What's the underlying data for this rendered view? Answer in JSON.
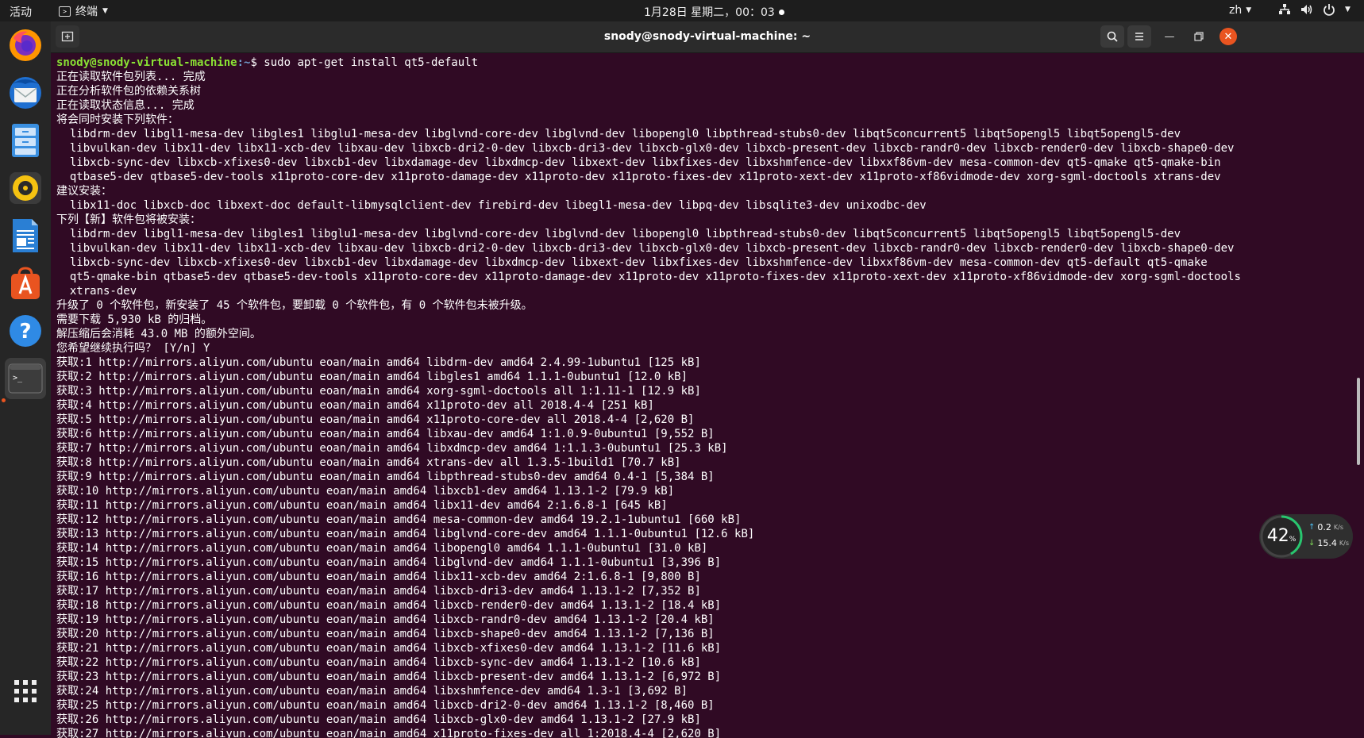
{
  "topbar": {
    "activities": "活动",
    "app_name": "终端",
    "clock": "1月28日 星期二，00：03",
    "lang": "zh"
  },
  "dock": {
    "items": [
      {
        "name": "firefox-icon"
      },
      {
        "name": "thunderbird-icon"
      },
      {
        "name": "files-icon"
      },
      {
        "name": "rhythmbox-icon"
      },
      {
        "name": "writer-icon"
      },
      {
        "name": "software-icon"
      },
      {
        "name": "help-icon"
      },
      {
        "name": "terminal-icon"
      },
      {
        "name": "show-apps-icon"
      }
    ]
  },
  "window": {
    "title": "snody@snody-virtual-machine: ~"
  },
  "terminal": {
    "prompt_user": "snody@snody-virtual-machine",
    "prompt_path": ":~",
    "prompt_cmd": "$ sudo apt-get install qt5-default",
    "lines": [
      "正在读取软件包列表... 完成",
      "正在分析软件包的依赖关系树",
      "正在读取状态信息... 完成",
      "将会同时安装下列软件：",
      "  libdrm-dev libgl1-mesa-dev libgles1 libglu1-mesa-dev libglvnd-core-dev libglvnd-dev libopengl0 libpthread-stubs0-dev libqt5concurrent5 libqt5opengl5 libqt5opengl5-dev",
      "  libvulkan-dev libx11-dev libx11-xcb-dev libxau-dev libxcb-dri2-0-dev libxcb-dri3-dev libxcb-glx0-dev libxcb-present-dev libxcb-randr0-dev libxcb-render0-dev libxcb-shape0-dev",
      "  libxcb-sync-dev libxcb-xfixes0-dev libxcb1-dev libxdamage-dev libxdmcp-dev libxext-dev libxfixes-dev libxshmfence-dev libxxf86vm-dev mesa-common-dev qt5-qmake qt5-qmake-bin",
      "  qtbase5-dev qtbase5-dev-tools x11proto-core-dev x11proto-damage-dev x11proto-dev x11proto-fixes-dev x11proto-xext-dev x11proto-xf86vidmode-dev xorg-sgml-doctools xtrans-dev",
      "建议安装：",
      "  libx11-doc libxcb-doc libxext-doc default-libmysqlclient-dev firebird-dev libegl1-mesa-dev libpq-dev libsqlite3-dev unixodbc-dev",
      "下列【新】软件包将被安装：",
      "  libdrm-dev libgl1-mesa-dev libgles1 libglu1-mesa-dev libglvnd-core-dev libglvnd-dev libopengl0 libpthread-stubs0-dev libqt5concurrent5 libqt5opengl5 libqt5opengl5-dev",
      "  libvulkan-dev libx11-dev libx11-xcb-dev libxau-dev libxcb-dri2-0-dev libxcb-dri3-dev libxcb-glx0-dev libxcb-present-dev libxcb-randr0-dev libxcb-render0-dev libxcb-shape0-dev",
      "  libxcb-sync-dev libxcb-xfixes0-dev libxcb1-dev libxdamage-dev libxdmcp-dev libxext-dev libxfixes-dev libxshmfence-dev libxxf86vm-dev mesa-common-dev qt5-default qt5-qmake",
      "  qt5-qmake-bin qtbase5-dev qtbase5-dev-tools x11proto-core-dev x11proto-damage-dev x11proto-dev x11proto-fixes-dev x11proto-xext-dev x11proto-xf86vidmode-dev xorg-sgml-doctools",
      "  xtrans-dev",
      "升级了 0 个软件包，新安装了 45 个软件包，要卸载 0 个软件包，有 0 个软件包未被升级。",
      "需要下载 5,930 kB 的归档。",
      "解压缩后会消耗 43.0 MB 的额外空间。",
      "您希望继续执行吗？ [Y/n] Y",
      "获取:1 http://mirrors.aliyun.com/ubuntu eoan/main amd64 libdrm-dev amd64 2.4.99-1ubuntu1 [125 kB]",
      "获取:2 http://mirrors.aliyun.com/ubuntu eoan/main amd64 libgles1 amd64 1.1.1-0ubuntu1 [12.0 kB]",
      "获取:3 http://mirrors.aliyun.com/ubuntu eoan/main amd64 xorg-sgml-doctools all 1:1.11-1 [12.9 kB]",
      "获取:4 http://mirrors.aliyun.com/ubuntu eoan/main amd64 x11proto-dev all 2018.4-4 [251 kB]",
      "获取:5 http://mirrors.aliyun.com/ubuntu eoan/main amd64 x11proto-core-dev all 2018.4-4 [2,620 B]",
      "获取:6 http://mirrors.aliyun.com/ubuntu eoan/main amd64 libxau-dev amd64 1:1.0.9-0ubuntu1 [9,552 B]",
      "获取:7 http://mirrors.aliyun.com/ubuntu eoan/main amd64 libxdmcp-dev amd64 1:1.1.3-0ubuntu1 [25.3 kB]",
      "获取:8 http://mirrors.aliyun.com/ubuntu eoan/main amd64 xtrans-dev all 1.3.5-1build1 [70.7 kB]",
      "获取:9 http://mirrors.aliyun.com/ubuntu eoan/main amd64 libpthread-stubs0-dev amd64 0.4-1 [5,384 B]",
      "获取:10 http://mirrors.aliyun.com/ubuntu eoan/main amd64 libxcb1-dev amd64 1.13.1-2 [79.9 kB]",
      "获取:11 http://mirrors.aliyun.com/ubuntu eoan/main amd64 libx11-dev amd64 2:1.6.8-1 [645 kB]",
      "获取:12 http://mirrors.aliyun.com/ubuntu eoan/main amd64 mesa-common-dev amd64 19.2.1-1ubuntu1 [660 kB]",
      "获取:13 http://mirrors.aliyun.com/ubuntu eoan/main amd64 libglvnd-core-dev amd64 1.1.1-0ubuntu1 [12.6 kB]",
      "获取:14 http://mirrors.aliyun.com/ubuntu eoan/main amd64 libopengl0 amd64 1.1.1-0ubuntu1 [31.0 kB]",
      "获取:15 http://mirrors.aliyun.com/ubuntu eoan/main amd64 libglvnd-dev amd64 1.1.1-0ubuntu1 [3,396 B]",
      "获取:16 http://mirrors.aliyun.com/ubuntu eoan/main amd64 libx11-xcb-dev amd64 2:1.6.8-1 [9,800 B]",
      "获取:17 http://mirrors.aliyun.com/ubuntu eoan/main amd64 libxcb-dri3-dev amd64 1.13.1-2 [7,352 B]",
      "获取:18 http://mirrors.aliyun.com/ubuntu eoan/main amd64 libxcb-render0-dev amd64 1.13.1-2 [18.4 kB]",
      "获取:19 http://mirrors.aliyun.com/ubuntu eoan/main amd64 libxcb-randr0-dev amd64 1.13.1-2 [20.4 kB]",
      "获取:20 http://mirrors.aliyun.com/ubuntu eoan/main amd64 libxcb-shape0-dev amd64 1.13.1-2 [7,136 B]",
      "获取:21 http://mirrors.aliyun.com/ubuntu eoan/main amd64 libxcb-xfixes0-dev amd64 1.13.1-2 [11.6 kB]",
      "获取:22 http://mirrors.aliyun.com/ubuntu eoan/main amd64 libxcb-sync-dev amd64 1.13.1-2 [10.6 kB]",
      "获取:23 http://mirrors.aliyun.com/ubuntu eoan/main amd64 libxcb-present-dev amd64 1.13.1-2 [6,972 B]",
      "获取:24 http://mirrors.aliyun.com/ubuntu eoan/main amd64 libxshmfence-dev amd64 1.3-1 [3,692 B]",
      "获取:25 http://mirrors.aliyun.com/ubuntu eoan/main amd64 libxcb-dri2-0-dev amd64 1.13.1-2 [8,460 B]",
      "获取:26 http://mirrors.aliyun.com/ubuntu eoan/main amd64 libxcb-glx0-dev amd64 1.13.1-2 [27.9 kB]",
      "获取:27 http://mirrors.aliyun.com/ubuntu eoan/main amd64 x11proto-fixes-dev all 1:2018.4-4 [2,620 B]"
    ]
  },
  "netwidget": {
    "percent": 42,
    "percent_sign": "%",
    "upload": "0.2",
    "upload_unit": "K/s",
    "download": "15.4",
    "download_unit": "K/s"
  },
  "colors": {
    "terminal_bg": "#300a24",
    "prompt_user": "#8ae234",
    "prompt_path": "#729fcf",
    "accent": "#e95420"
  }
}
